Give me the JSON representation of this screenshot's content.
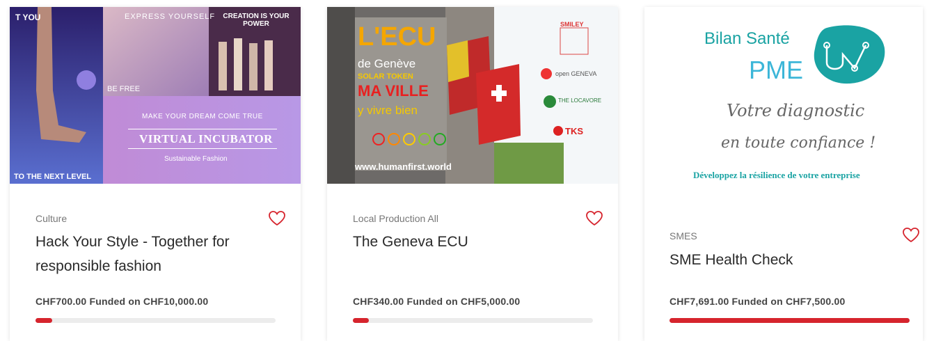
{
  "projects": [
    {
      "category": "Culture",
      "title": "Hack Your Style - Together for responsible fashion",
      "funded_text": "CHF700.00 Funded on CHF10,000.00",
      "progress": 0.07,
      "image_text": {
        "t1": "T YOU",
        "t2": "EXPRESS YOURSELF",
        "t3": "CREATION IS YOUR POWER",
        "t4": "BE FREE",
        "t5": "MAKE YOUR DREAM COME TRUE",
        "t6": "VIRTUAL INCUBATOR",
        "t7": "Sustainable Fashion",
        "t8": "TO THE NEXT LEVEL"
      }
    },
    {
      "category": "Local Production All",
      "title": "The Geneva ECU",
      "funded_text": "CHF340.00 Funded on CHF5,000.00",
      "progress": 0.068,
      "image_text": {
        "ecu": "L'ECU",
        "geneve": "de Genève",
        "solar": "SOLAR TOKEN",
        "ville": "MA VILLE",
        "vivre": "y vivre bien",
        "url": "www.humanfirst.world",
        "logo1": "SMILEY",
        "logo2": "open GENEVA",
        "logo3": "THE LOCAVORE",
        "logo4": "TKS"
      }
    },
    {
      "category": "SMES",
      "title": "SME Health Check",
      "funded_text": "CHF7,691.00 Funded on CHF7,500.00",
      "progress": 1.0,
      "image_text": {
        "bilan": "Bilan Santé",
        "pme": "PME",
        "tag1": "Votre diagnostic",
        "tag2": "en toute confiance !",
        "tag3": "Développez la résilience de votre entreprise"
      }
    }
  ],
  "colors": {
    "accent": "#d6242d",
    "track": "#ececec",
    "teal": "#1aa3a3"
  }
}
